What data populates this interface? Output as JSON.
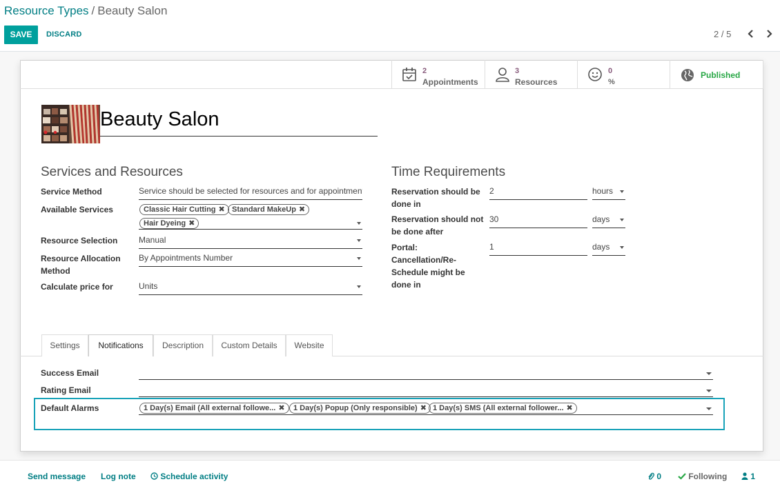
{
  "breadcrumb": {
    "parent": "Resource Types",
    "separator": "/",
    "current": "Beauty Salon"
  },
  "actions": {
    "save": "SAVE",
    "discard": "DISCARD"
  },
  "pager": {
    "value": "2 / 5"
  },
  "smart_buttons": {
    "appointments": {
      "count": "2",
      "label": "Appointments"
    },
    "resources": {
      "count": "3",
      "label": "Resources"
    },
    "rating": {
      "count": "0",
      "label": "%"
    },
    "published": {
      "label": "Published"
    }
  },
  "record": {
    "name": "Beauty Salon"
  },
  "services": {
    "title": "Services and Resources",
    "service_method": {
      "label": "Service Method",
      "value": "Service should be selected for resources and for appointments"
    },
    "available_services": {
      "label": "Available Services",
      "tags": [
        "Classic Hair Cutting",
        "Standard MakeUp",
        "Hair Dyeing"
      ]
    },
    "resource_selection": {
      "label": "Resource Selection",
      "value": "Manual"
    },
    "resource_allocation": {
      "label_line1": "Resource Allocation",
      "label_line2": "Method",
      "value": "By Appointments Number"
    },
    "calculate_price": {
      "label": "Calculate price for",
      "value": "Units"
    }
  },
  "time": {
    "title": "Time Requirements",
    "before": {
      "label_line1": "Reservation should be",
      "label_line2": "done in",
      "value": "2",
      "unit": "hours"
    },
    "not_after": {
      "label_line1": "Reservation should not",
      "label_line2": "be done after",
      "value": "30",
      "unit": "days"
    },
    "portal": {
      "label_line1": "Portal:",
      "label_line2": "Cancellation/Re-",
      "label_line3": "Schedule might be",
      "label_line4": "done in",
      "value": "1",
      "unit": "days"
    }
  },
  "tabs": [
    "Settings",
    "Notifications",
    "Description",
    "Custom Details",
    "Website"
  ],
  "active_tab": "Notifications",
  "notifications": {
    "success_email": {
      "label": "Success Email",
      "value": ""
    },
    "rating_email": {
      "label": "Rating Email",
      "value": ""
    },
    "default_alarms": {
      "label": "Default Alarms",
      "tags": [
        "1 Day(s) Email (All external followe...",
        "1 Day(s) Popup (Only responsible)",
        "1 Day(s) SMS (All external follower..."
      ]
    }
  },
  "chatter": {
    "send_message": "Send message",
    "log_note": "Log note",
    "schedule_activity": "Schedule activity",
    "attachments": "0",
    "following": "Following",
    "followers": "1"
  },
  "colors": {
    "primary": "#00a09d",
    "link": "#017e84",
    "smart_count": "#875a7b",
    "published": "#28a745",
    "focus": "#17a2b8"
  }
}
